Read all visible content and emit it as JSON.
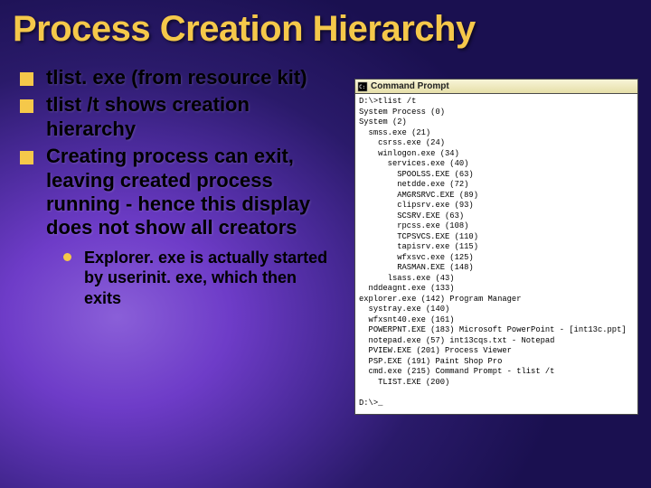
{
  "title": "Process Creation Hierarchy",
  "bullets": [
    "tlist. exe (from resource kit)",
    "tlist /t shows creation hierarchy",
    "Creating process can exit, leaving created process running - hence this display does not show all creators"
  ],
  "subbullet": "Explorer. exe is actually started by userinit. exe, which then exits",
  "window_title": "Command Prompt",
  "console_lines": [
    "D:\\>tlist /t",
    "System Process (0)",
    "System (2)",
    "  smss.exe (21)",
    "    csrss.exe (24)",
    "    winlogon.exe (34)",
    "      services.exe (40)",
    "        SPOOLSS.EXE (63)",
    "        netdde.exe (72)",
    "        AMGRSRVC.EXE (89)",
    "        clipsrv.exe (93)",
    "        SCSRV.EXE (63)",
    "        rpcss.exe (108)",
    "        TCPSVCS.EXE (110)",
    "        tapisrv.exe (115)",
    "        wfxsvc.exe (125)",
    "        RASMAN.EXE (148)",
    "      lsass.exe (43)",
    "  nddeagnt.exe (133)",
    "explorer.exe (142) Program Manager",
    "  systray.exe (140)",
    "  wfxsnt40.exe (161)",
    "  POWERPNT.EXE (183) Microsoft PowerPoint - [int13c.ppt]",
    "  notepad.exe (57) int13cqs.txt - Notepad",
    "  PVIEW.EXE (201) Process Viewer",
    "  PSP.EXE (191) Paint Shop Pro",
    "  cmd.exe (215) Command Prompt - tlist /t",
    "    TLIST.EXE (200)",
    "",
    "D:\\>_"
  ]
}
